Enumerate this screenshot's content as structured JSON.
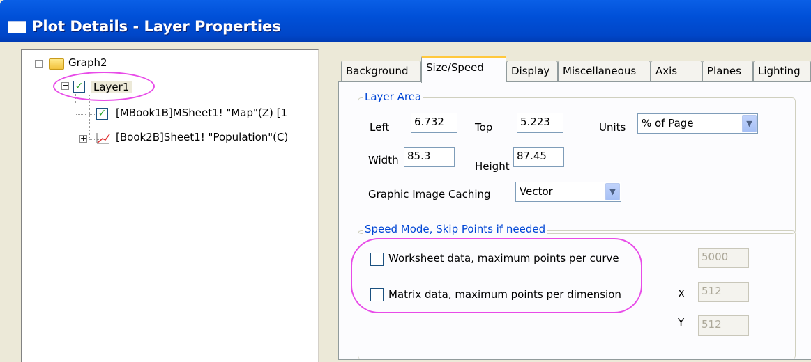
{
  "window": {
    "title": "Plot Details - Layer Properties"
  },
  "tree": {
    "root_label": "Graph2",
    "layer_label": "Layer1",
    "items": [
      {
        "label": "[MBook1B]MSheet1! \"Map\"(Z) [1"
      },
      {
        "label": "[Book2B]Sheet1! \"Population\"(C)"
      }
    ]
  },
  "tabs": [
    {
      "label": "Background",
      "active": false
    },
    {
      "label": "Size/Speed",
      "active": true
    },
    {
      "label": "Display",
      "active": false
    },
    {
      "label": "Miscellaneous",
      "active": false
    },
    {
      "label": "Axis",
      "active": false
    },
    {
      "label": "Planes",
      "active": false
    },
    {
      "label": "Lighting",
      "active": false
    }
  ],
  "layer_area": {
    "title": "Layer Area",
    "left_label": "Left",
    "left_value": "6.732",
    "top_label": "Top",
    "top_value": "5.223",
    "units_label": "Units",
    "units_value": "% of Page",
    "width_label": "Width",
    "width_value": "85.3",
    "height_label": "Height",
    "height_value": "87.45",
    "caching_label": "Graphic Image Caching",
    "caching_value": "Vector"
  },
  "speed_mode": {
    "title": "Speed Mode, Skip Points if needed",
    "worksheet_label": "Worksheet data, maximum points per curve",
    "worksheet_checked": false,
    "worksheet_value": "5000",
    "matrix_label": "Matrix data, maximum points per dimension",
    "matrix_checked": false,
    "x_label": "X",
    "x_value": "512",
    "y_label": "Y",
    "y_value": "512"
  },
  "colors": {
    "title_bar": "#0050d8",
    "group_title": "#0046d5",
    "highlight": "#e84be8",
    "active_tab_accent": "#ffc83c",
    "check_green": "#21a121"
  }
}
